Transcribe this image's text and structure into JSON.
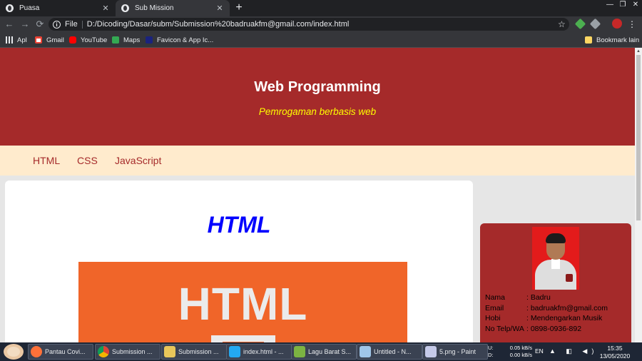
{
  "browser": {
    "tabs": [
      {
        "label": "Puasa",
        "active": false
      },
      {
        "label": "Sub Mission",
        "active": true
      }
    ],
    "tab_close_glyph": "✕",
    "new_tab_glyph": "+",
    "window_controls": [
      "—",
      "❐",
      "✕"
    ],
    "omnibox": {
      "protocol": "File",
      "url": "D:/Dicoding/Dasar/subm/Submission%20badruakfm@gmail.com/index.html"
    },
    "nav_glyphs": {
      "back": "←",
      "forward": "→",
      "reload": "⟳"
    },
    "star_glyph": "☆",
    "menu_glyph": "⋮",
    "bookmarks": [
      {
        "label": "Apl",
        "icon": "apps-grid-icon"
      },
      {
        "label": "Gmail",
        "icon": "gmail-icon"
      },
      {
        "label": "YouTube",
        "icon": "youtube-icon"
      },
      {
        "label": "Maps",
        "icon": "maps-icon"
      },
      {
        "label": "Favicon & App Ic...",
        "icon": "favicon-icon"
      }
    ],
    "other_bookmarks": "Bookmark lain"
  },
  "page": {
    "header": {
      "title": "Web Programming",
      "tagline": "Pemrogaman berbasis web",
      "background": "#a52a2a",
      "tagline_color": "#ffff00"
    },
    "nav": [
      "HTML",
      "CSS",
      "JavaScript"
    ],
    "content": {
      "heading": "HTML",
      "heading_color": "#0000ff",
      "logo_text": "HTML",
      "logo_color": "#f06529"
    },
    "profile": {
      "photo_background": "#e31b1b",
      "rows": [
        {
          "label": "Nama",
          "value": ": Badru"
        },
        {
          "label": "Email",
          "value": ": badruakfm@gmail.com"
        },
        {
          "label": "Hobi",
          "value": ": Mendengarkan Musik"
        },
        {
          "label": "No Telp/WA",
          "value": ": 0898-0936-892"
        }
      ]
    }
  },
  "taskbar": {
    "buttons": [
      {
        "label": "Pantau Covi...",
        "icon": "firefox-icon"
      },
      {
        "label": "Submission ...",
        "icon": "chrome-icon"
      },
      {
        "label": "Submission ...",
        "icon": "folder-icon"
      },
      {
        "label": "index.html - ...",
        "icon": "vscode-icon"
      },
      {
        "label": "Lagu Barat S...",
        "icon": "media-player-icon"
      },
      {
        "label": "Untitled - N...",
        "icon": "notepad-icon"
      },
      {
        "label": "5.png - Paint",
        "icon": "paint-icon"
      }
    ],
    "net": {
      "up_label": "U:",
      "up_value": "0.05 kB/s",
      "down_label": "D:",
      "down_value": "0.00 kB/s"
    },
    "language": "EN",
    "tray_glyphs": "▲ ◧ ◀)",
    "time": "15:35",
    "date": "13/05/2020"
  }
}
